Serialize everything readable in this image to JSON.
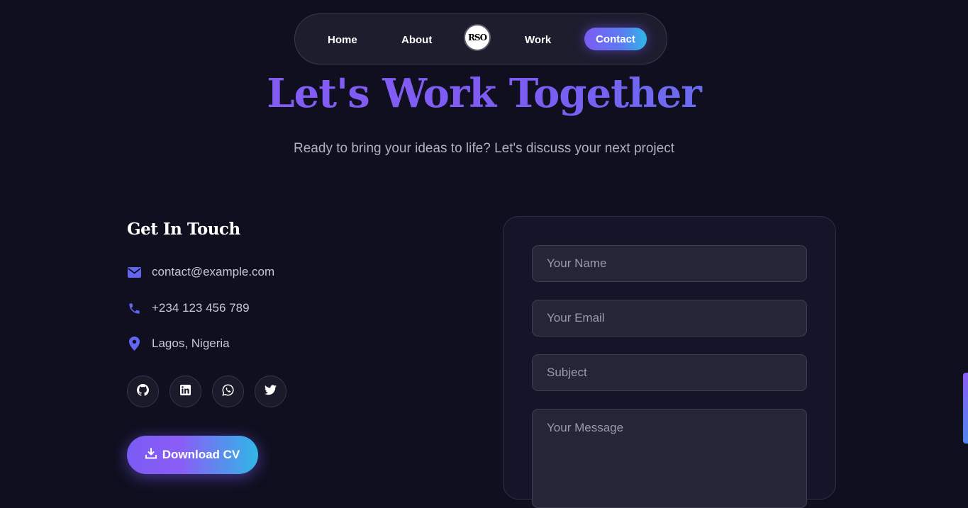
{
  "nav": {
    "home": "Home",
    "about": "About",
    "logo_text": "RSO",
    "work": "Work",
    "contact": "Contact"
  },
  "hero": {
    "title": "Let's Work Together",
    "subtitle": "Ready to bring your ideas to life? Let's discuss your next project"
  },
  "touch": {
    "title": "Get In Touch",
    "email": "contact@example.com",
    "phone": "+234 123 456 789",
    "location": "Lagos, Nigeria",
    "socials": [
      "github-icon",
      "linkedin-icon",
      "whatsapp-icon",
      "twitter-icon"
    ],
    "download_cv": "Download CV"
  },
  "form": {
    "name_placeholder": "Your Name",
    "email_placeholder": "Your Email",
    "subject_placeholder": "Subject",
    "message_placeholder": "Your Message"
  },
  "colors": {
    "background": "#0f0f1f",
    "accent_purple": "#8b5cf6",
    "accent_blue": "#2fb7e6",
    "icon_color": "#6366f1"
  }
}
